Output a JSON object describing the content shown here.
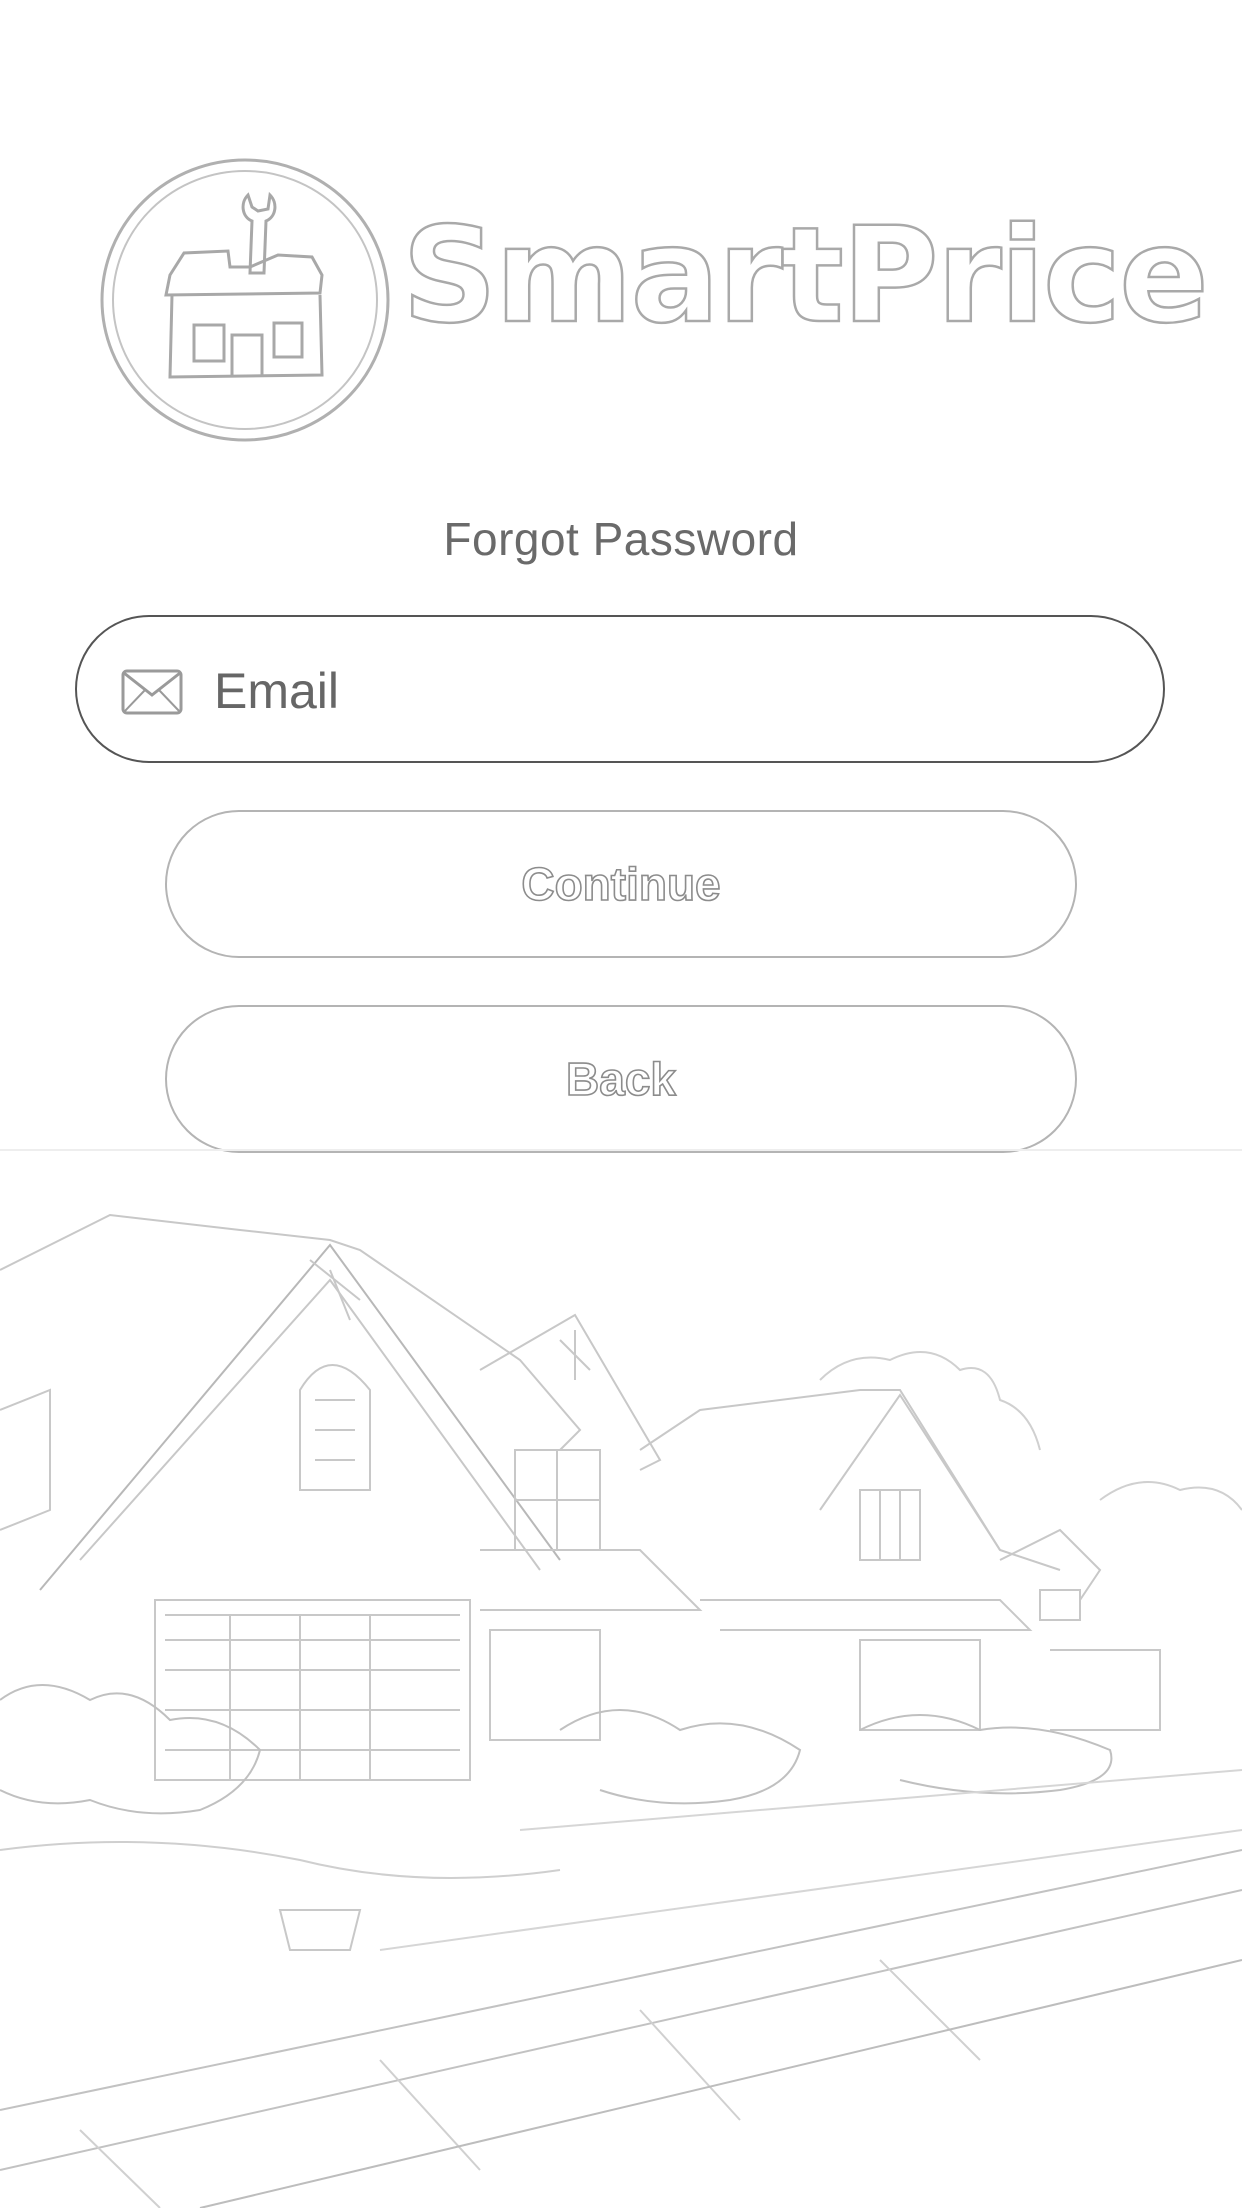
{
  "app": {
    "brand_name": "SmartPrice"
  },
  "screen": {
    "title": "Forgot Password"
  },
  "email": {
    "placeholder": "Email",
    "value": ""
  },
  "buttons": {
    "continue_label": "Continue",
    "back_label": "Back"
  },
  "icons": {
    "logo": "house-tools-logo",
    "email": "envelope-icon",
    "background": "house-sketch-illustration"
  },
  "colors": {
    "background": "#ffffff",
    "text": "#6a6a6a",
    "field_border": "#555555",
    "button_border": "#b4b4b4"
  }
}
